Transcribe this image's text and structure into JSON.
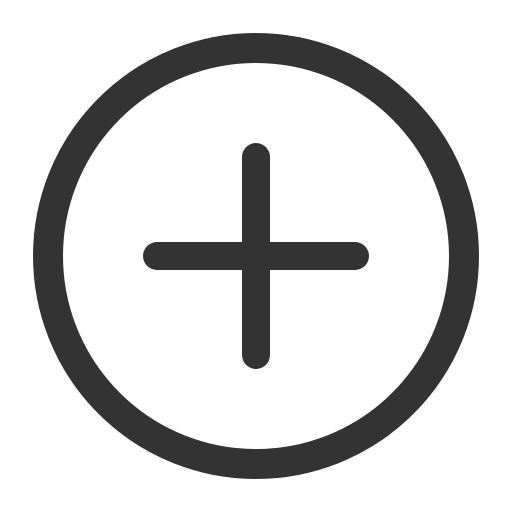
{
  "icon": {
    "name": "add-circle-icon",
    "color": "#333333",
    "background": "#ffffff"
  }
}
